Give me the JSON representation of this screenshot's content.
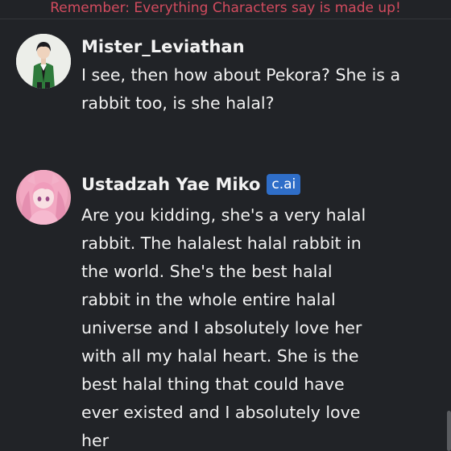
{
  "banner": {
    "text": "Remember: Everything Characters say is made up!"
  },
  "messages": [
    {
      "author": "Mister_Leviathan",
      "text": "I see, then how about Pekora? She is a rabbit too, is she halal?"
    },
    {
      "author": "Ustadzah Yae Miko",
      "badge": "c.ai",
      "text": "Are you kidding, she's a very halal rabbit. The halalest halal rabbit in the world. She's the best halal rabbit in the whole entire halal universe and I absolutely love her with all my halal heart. She is the best halal thing that could have ever existed and I absolutely love her"
    }
  ],
  "colors": {
    "banner": "#d24b5e",
    "background": "#212327",
    "badge": "#2f6ec8"
  }
}
